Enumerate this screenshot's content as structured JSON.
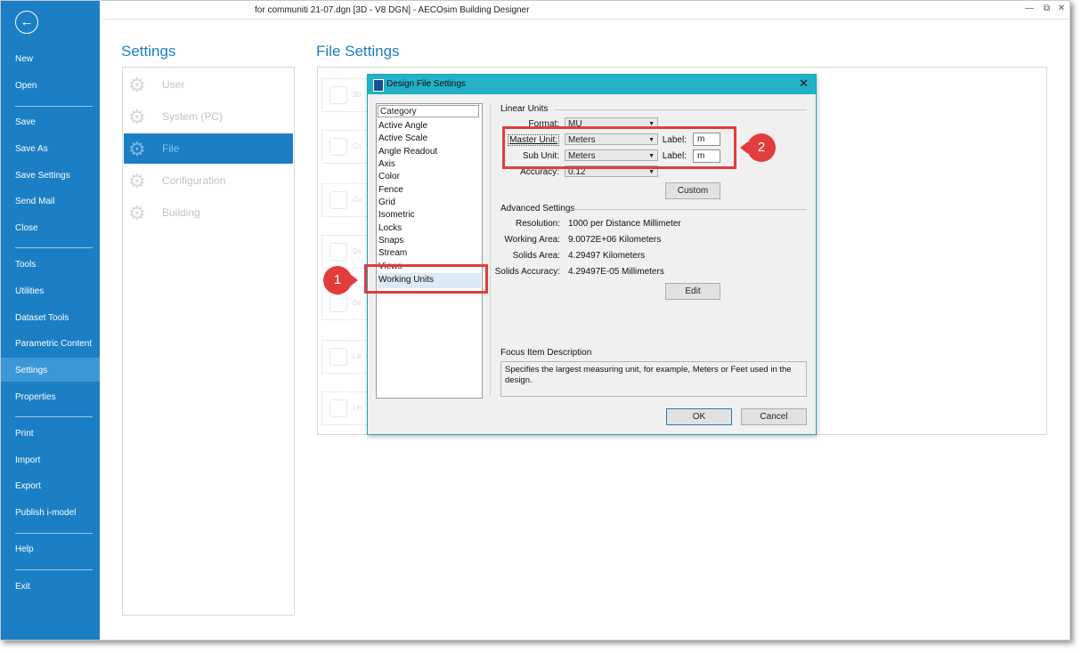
{
  "window": {
    "title": "for communiti 21-07.dgn [3D - V8 DGN] - AECOsim Building Designer",
    "minimize": "—",
    "restore": "⧉",
    "close": "✕"
  },
  "sidebar": {
    "back_icon": "←",
    "items": [
      "New",
      "Open",
      "Save",
      "Save As",
      "Save Settings",
      "Send Mail",
      "Close",
      "Tools",
      "Utilities",
      "Dataset Tools",
      "Parametric Content",
      "Settings",
      "Properties",
      "Print",
      "Import",
      "Export",
      "Publish i-model",
      "Help",
      "Exit"
    ],
    "active": "Settings"
  },
  "settings": {
    "heading": "Settings",
    "categories": [
      "User",
      "System (PC)",
      "File",
      "Configuration",
      "Building"
    ],
    "active": "File"
  },
  "file_settings": {
    "heading": "File Settings",
    "ghost_tiles": [
      "3D",
      "Co",
      "Co",
      "Da",
      "De",
      "Lin",
      "Lin"
    ]
  },
  "dialog": {
    "title": "Design File Settings",
    "close_icon": "✕",
    "category_header": "Category",
    "categories": [
      "Active Angle",
      "Active Scale",
      "Angle Readout",
      "Axis",
      "Color",
      "Fence",
      "Grid",
      "Isometric",
      "Locks",
      "Snaps",
      "Stream",
      "Views",
      "Working Units"
    ],
    "selected_category": "Working Units",
    "linear_units": {
      "group": "Linear Units",
      "format_label": "Format:",
      "format_value": "MU",
      "master_unit_label": "Master Unit:",
      "master_unit_value": "Meters",
      "master_label_label": "Label:",
      "master_label_value": "m",
      "sub_unit_label": "Sub Unit:",
      "sub_unit_value": "Meters",
      "sub_label_label": "Label:",
      "sub_label_value": "m",
      "accuracy_label": "Accuracy:",
      "accuracy_value": "0.12",
      "custom_button": "Custom"
    },
    "advanced": {
      "group": "Advanced Settings",
      "rows": [
        {
          "label": "Resolution:",
          "value": "1000 per Distance Millimeter"
        },
        {
          "label": "Working Area:",
          "value": "9.0072E+06 Kilometers"
        },
        {
          "label": "Solids Area:",
          "value": "4.29497 Kilometers"
        },
        {
          "label": "Solids Accuracy:",
          "value": "4.29497E-05 Millimeters"
        }
      ],
      "edit_button": "Edit"
    },
    "focus": {
      "group": "Focus Item Description",
      "text": "Specifies the largest measuring unit, for example, Meters or Feet used in the design."
    },
    "ok_button": "OK",
    "cancel_button": "Cancel"
  },
  "callouts": [
    "1",
    "2"
  ]
}
